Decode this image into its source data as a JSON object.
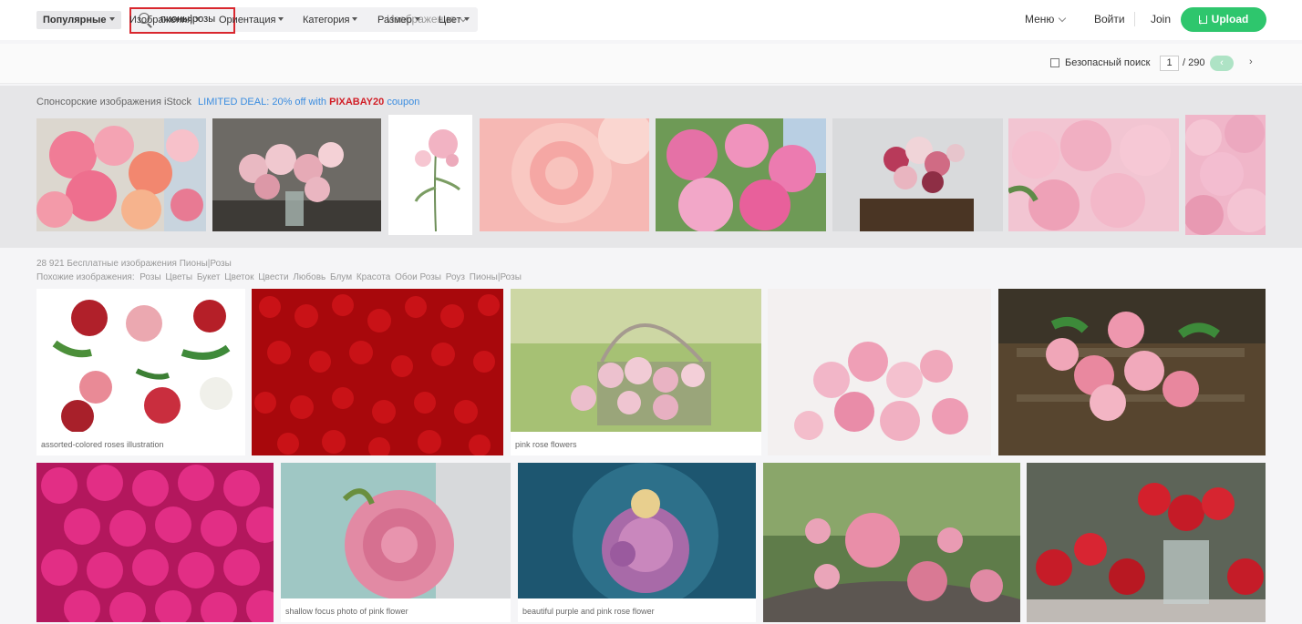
{
  "header": {
    "logo": "pixabay",
    "search_value": "пионы|розы",
    "type_select": "Изображения",
    "menu_label": "Меню",
    "login_label": "Войти",
    "join_label": "Join",
    "upload_label": "Upload",
    "brand_color": "#2ec66d"
  },
  "filters": {
    "items": [
      "Популярные",
      "Изображения",
      "Ориентация",
      "Категория",
      "Размер",
      "Цвет"
    ],
    "safe_search_label": "Безопасный поиск",
    "safe_search_checked": false,
    "page_current": "1",
    "page_total": "/ 290"
  },
  "sponsor": {
    "text": "Спонсорские изображения iStock",
    "deal_prefix": "LIMITED DEAL: 20% off with",
    "deal_code": "PIXABAY20",
    "deal_suffix": "coupon"
  },
  "results": {
    "count_text": "28 921 Бесплатные изображения Пионы|Розы",
    "related_label": "Похожие изображения:",
    "related_tags": [
      "Розы",
      "Цветы",
      "Букет",
      "Цветок",
      "Цвести",
      "Любовь",
      "Блум",
      "Красота",
      "Обои Розы",
      "Роуз",
      "Пионы|Розы"
    ]
  },
  "grid": {
    "row1_captions": [
      "assorted-colored roses illustration",
      "",
      "pink rose flowers",
      "",
      ""
    ],
    "row2_captions": [
      "",
      "shallow focus photo of pink flower",
      "beautiful purple and pink rose flower",
      "",
      ""
    ]
  }
}
